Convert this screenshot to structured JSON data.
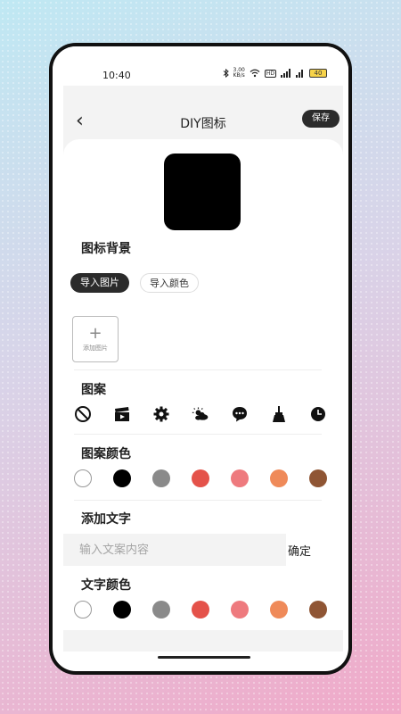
{
  "status": {
    "time": "10:40",
    "speed_value": "3.00",
    "speed_unit": "KB/s",
    "hd": "HD",
    "battery": "40"
  },
  "header": {
    "title": "DIY图标",
    "save_label": "保存",
    "back_glyph": "‹"
  },
  "background_section": {
    "label": "图标背景",
    "import_image": "导入图片",
    "import_color": "导入颜色",
    "add_image_glyph": "+",
    "add_image_label": "添加图片"
  },
  "pattern_section": {
    "label": "图案",
    "icons": [
      "none-icon",
      "clapperboard-icon",
      "gear-icon",
      "weather-icon",
      "chat-icon",
      "broom-icon",
      "clock-icon"
    ]
  },
  "pattern_color_section": {
    "label": "图案颜色",
    "colors": [
      "#ffffff",
      "#000000",
      "#8a8a8a",
      "#e4524a",
      "#ee7a7e",
      "#ef8a59",
      "#8f5534"
    ]
  },
  "text_section": {
    "label": "添加文字",
    "placeholder": "输入文案内容",
    "confirm_label": "确定"
  },
  "text_color_section": {
    "label": "文字颜色",
    "colors": [
      "#ffffff",
      "#000000",
      "#8a8a8a",
      "#e4524a",
      "#ee7a7e",
      "#ef8a59",
      "#8f5534"
    ]
  }
}
